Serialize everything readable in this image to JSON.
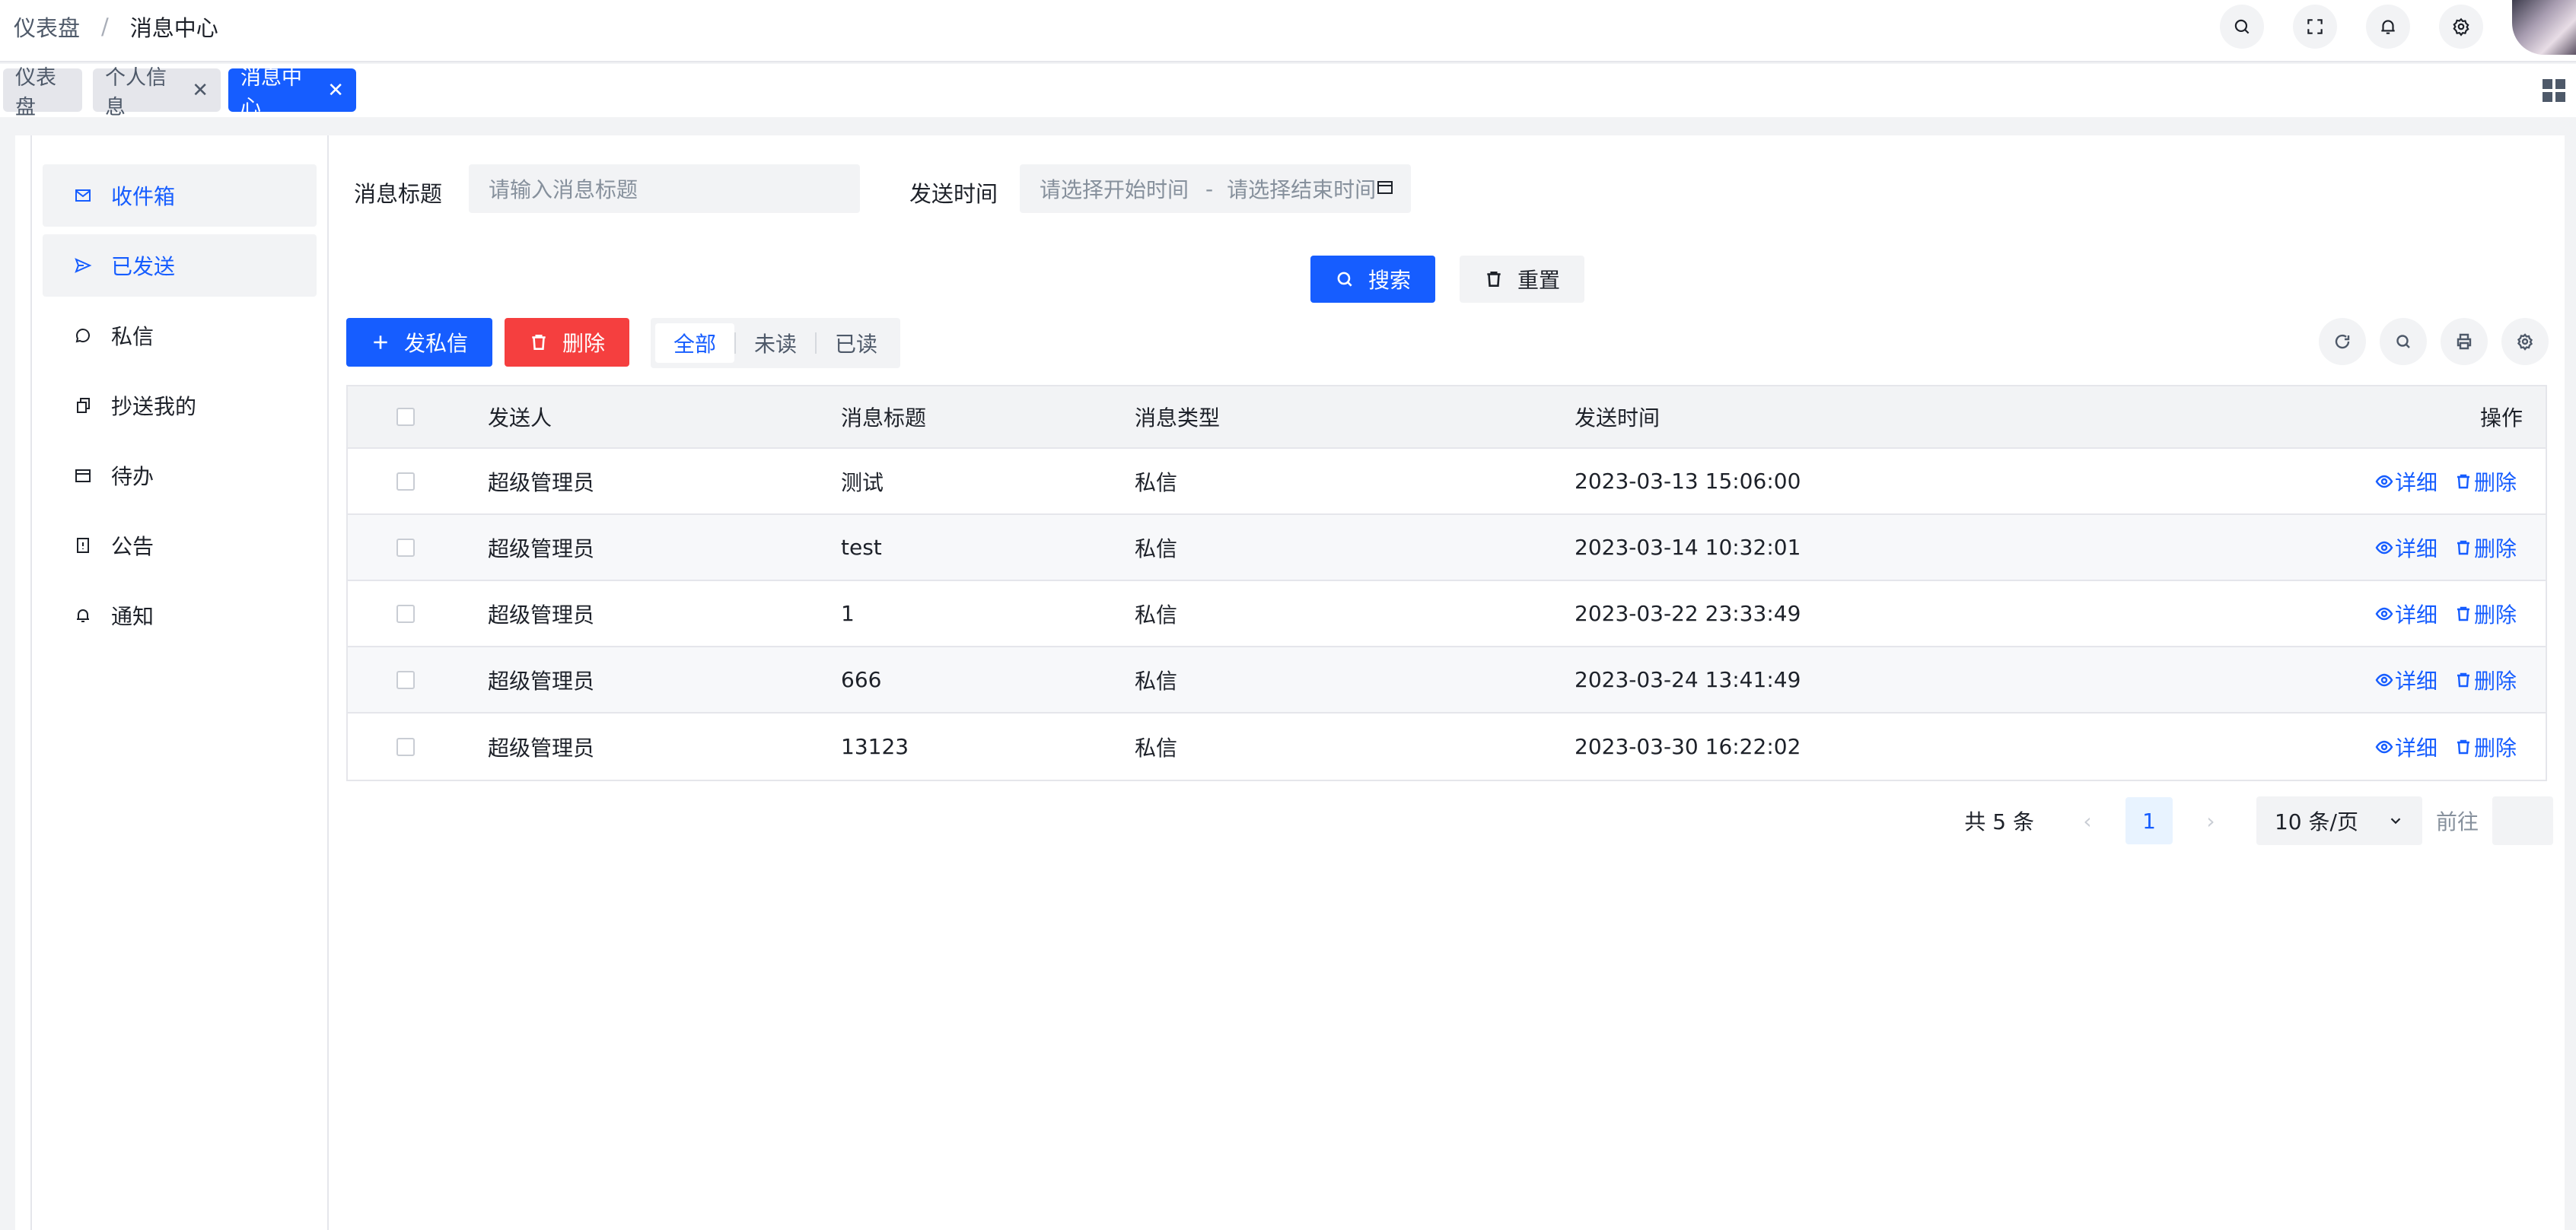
{
  "breadcrumb": {
    "root": "仪表盘",
    "separator": "/",
    "current": "消息中心"
  },
  "header_icons": [
    "search-icon",
    "fullscreen-icon",
    "bell-icon",
    "gear-icon"
  ],
  "tabs": [
    {
      "label": "仪表盘",
      "closable": false,
      "active": false
    },
    {
      "label": "个人信息",
      "closable": true,
      "active": false
    },
    {
      "label": "消息中心",
      "closable": true,
      "active": true
    }
  ],
  "tab_close_glyph": "✕",
  "sidebar": {
    "items": [
      {
        "label": "收件箱",
        "icon": "mail-icon"
      },
      {
        "label": "已发送",
        "icon": "send-icon"
      },
      {
        "label": "私信",
        "icon": "chat-icon"
      },
      {
        "label": "抄送我的",
        "icon": "copy-icon"
      },
      {
        "label": "待办",
        "icon": "calendar-icon"
      },
      {
        "label": "公告",
        "icon": "notice-icon"
      },
      {
        "label": "通知",
        "icon": "bell-icon"
      }
    ],
    "active_index": 1
  },
  "filters": {
    "title_label": "消息标题",
    "title_placeholder": "请输入消息标题",
    "time_label": "发送时间",
    "start_placeholder": "请选择开始时间",
    "range_separator": "-",
    "end_placeholder": "请选择结束时间"
  },
  "buttons": {
    "search": "搜索",
    "reset": "重置",
    "send": "发私信",
    "delete": "删除"
  },
  "read_filter": {
    "options": [
      "全部",
      "未读",
      "已读"
    ],
    "selected": "全部"
  },
  "table": {
    "columns": [
      "发送人",
      "消息标题",
      "消息类型",
      "发送时间",
      "操作"
    ],
    "rows": [
      {
        "sender": "超级管理员",
        "title": "测试",
        "type": "私信",
        "time": "2023-03-13 15:06:00"
      },
      {
        "sender": "超级管理员",
        "title": "test",
        "type": "私信",
        "time": "2023-03-14 10:32:01"
      },
      {
        "sender": "超级管理员",
        "title": "1",
        "type": "私信",
        "time": "2023-03-22 23:33:49"
      },
      {
        "sender": "超级管理员",
        "title": "666",
        "type": "私信",
        "time": "2023-03-24 13:41:49"
      },
      {
        "sender": "超级管理员",
        "title": "13123",
        "type": "私信",
        "time": "2023-03-30 16:22:02"
      }
    ],
    "row_actions": {
      "detail": "详细",
      "delete": "删除"
    }
  },
  "pagination": {
    "total": "共 5 条",
    "prev": "‹",
    "current_page": "1",
    "next": "›",
    "page_size": "10 条/页",
    "goto": "前往"
  },
  "colors": {
    "primary": "#165dff",
    "danger": "#f53f3f",
    "background": "#f2f3f5"
  }
}
